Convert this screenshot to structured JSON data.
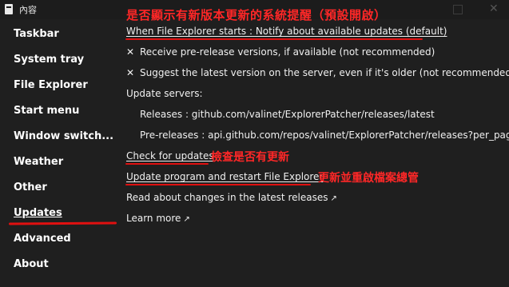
{
  "window": {
    "title": "內容",
    "close_glyph": "✕"
  },
  "annotations": {
    "top": "是否顯示有新版本更新的系統提醒（預設開啟）",
    "check_updates": "檢查是否有更新",
    "restart": "更新並重啟檔案總管"
  },
  "sidebar": {
    "items": [
      {
        "label": "Taskbar"
      },
      {
        "label": "System tray"
      },
      {
        "label": "File Explorer"
      },
      {
        "label": "Start menu"
      },
      {
        "label": "Window switch..."
      },
      {
        "label": "Weather"
      },
      {
        "label": "Other"
      },
      {
        "label": "Updates",
        "active": true
      },
      {
        "label": "Advanced"
      },
      {
        "label": "About"
      }
    ]
  },
  "main": {
    "notify_option": "When File Explorer starts : Notify about available updates (default)",
    "prerelease_option": "Receive pre-release versions, if available (not recommended)",
    "suggest_option": "Suggest the latest version on the server, even if it's older (not recommended)",
    "servers_heading": "Update servers:",
    "releases_url": "Releases : github.com/valinet/ExplorerPatcher/releases/latest",
    "prereleases_url": "Pre-releases : api.github.com/repos/valinet/ExplorerPatcher/releases?per_pag...",
    "check_updates": "Check for updates",
    "update_restart": "Update program and restart File Explorer",
    "read_changes": "Read about changes in the latest releases",
    "learn_more": "Learn more",
    "x_glyph": "✕",
    "arrow_glyph": "↗"
  },
  "colors": {
    "background": "#1f1f1f",
    "text": "#f2f2f2",
    "annotation_red": "#ff2727"
  },
  "icons": {
    "app": "window-app-icon",
    "maximize": "maximize-icon",
    "close": "close-icon",
    "checkbox_off": "x-icon",
    "external_link": "arrow-up-right-icon"
  }
}
